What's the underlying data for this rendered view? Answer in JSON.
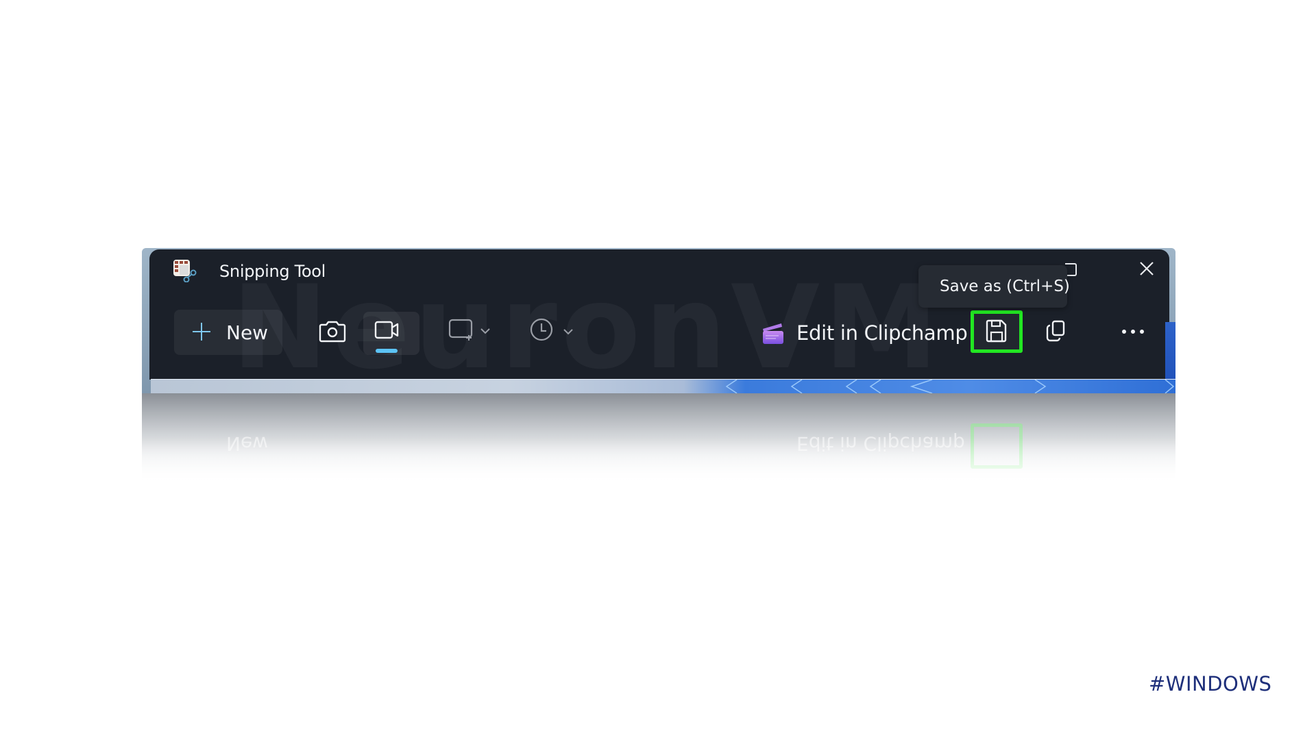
{
  "window": {
    "app_name": "Snipping Tool",
    "app_icon": "snipping-tool-icon",
    "watermark": "NeuronVM",
    "controls": [
      {
        "name": "maximize",
        "icon": "maximize-icon"
      },
      {
        "name": "close",
        "icon": "close-icon"
      }
    ]
  },
  "toolbar": {
    "new_label": "New",
    "new_icon": "plus-icon",
    "mode_buttons": [
      {
        "name": "screenshot-mode",
        "icon": "camera-icon",
        "selected": false
      },
      {
        "name": "record-mode",
        "icon": "video-camera-icon",
        "selected": true
      }
    ],
    "snip_shape_icon": "rectangle-snip-icon",
    "delay_icon": "clock-icon",
    "clipchamp_label": "Edit in Clipchamp",
    "clipchamp_icon": "clipchamp-icon",
    "save_icon": "save-icon",
    "copy_icon": "copy-icon",
    "more_icon": "more-icon"
  },
  "tooltip": {
    "text": "Save as (Ctrl+S)"
  },
  "highlight": {
    "target": "save-button",
    "color": "#22e622"
  },
  "colors": {
    "panel": "#1b2029",
    "text": "#f2f4f7",
    "selected_indicator": "#5cc3f5",
    "hashtag": "#1e2f7a"
  },
  "reflection": {
    "new_label": "New",
    "clipchamp_label": "Edit in Clipchamp"
  },
  "footer": {
    "hashtag": "#WINDOWS"
  }
}
